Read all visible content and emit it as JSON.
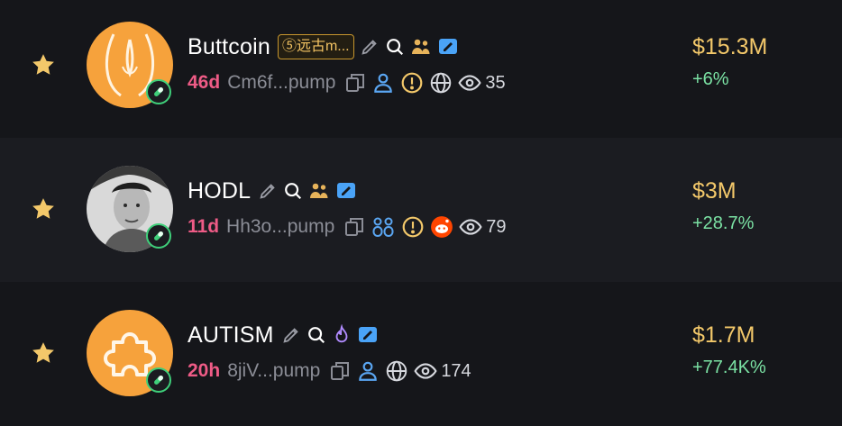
{
  "rows": [
    {
      "name": "Buttcoin",
      "tag": "⑤远古m...",
      "age": "46d",
      "address": "Cm6f...pump",
      "views": "35",
      "market_cap": "$15.3M",
      "change": "+6%"
    },
    {
      "name": "HODL",
      "age": "11d",
      "address": "Hh3o...pump",
      "views": "79",
      "market_cap": "$3M",
      "change": "+28.7%"
    },
    {
      "name": "AUTISM",
      "age": "20h",
      "address": "8jiV...pump",
      "views": "174",
      "market_cap": "$1.7M",
      "change": "+77.4K%"
    }
  ],
  "colors": {
    "background": "#15161a",
    "alt_row": "#1b1c21",
    "name": "#ffffff",
    "age": "#ee5b86",
    "address": "#8b8d96",
    "market_cap": "#f3c86a",
    "change_positive": "#7be2a4",
    "star": "#f3c86a",
    "verified_badge": "#4aa3f7",
    "pill_badge": "#3fcf7a",
    "warning": "#f3c86a",
    "reddit": "#ff4500",
    "avatar_orange": "#f6a23c"
  }
}
